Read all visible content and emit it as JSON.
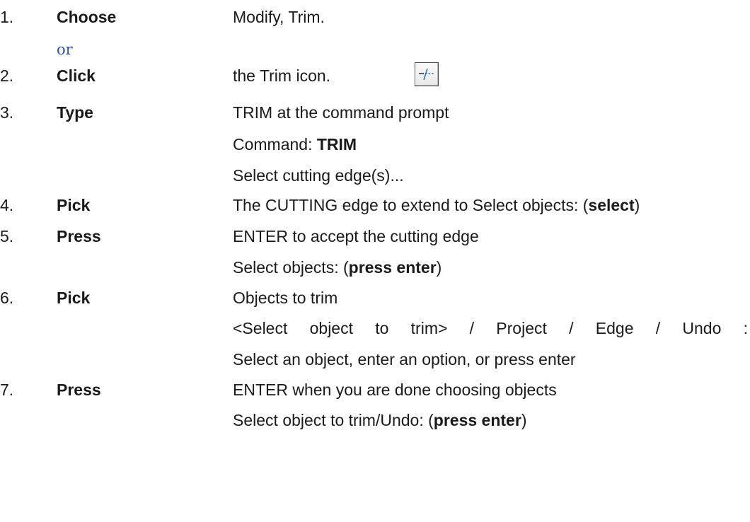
{
  "steps": [
    {
      "number": "1.",
      "verb": "Choose",
      "desc": "Modify, Trim."
    },
    {
      "number": "2.",
      "verb": "Click",
      "desc": "the Trim icon.",
      "icon": "trim-icon"
    },
    {
      "number": "3.",
      "verb": "Type",
      "desc": "TRIM at the command prompt",
      "command_prefix": "Command: ",
      "command_bold": "TRIM",
      "note": "Select cutting edge(s)..."
    },
    {
      "number": "4.",
      "verb": "Pick",
      "desc_prefix": "The CUTTING edge to extend to Select objects: (",
      "desc_bold": "select",
      "desc_suffix": ")"
    },
    {
      "number": "5.",
      "verb": "Press",
      "desc": "ENTER to accept the cutting edge",
      "prompt_prefix": "Select objects: (",
      "prompt_bold": "press enter",
      "prompt_suffix": ")"
    },
    {
      "number": "6.",
      "verb": "Pick",
      "desc": "Objects to trim",
      "options_line": "<Select object to trim> / Project / Edge / Undo :",
      "options_line2": "Select an object, enter an option, or press enter"
    },
    {
      "number": "7.",
      "verb": "Press",
      "desc": "ENTER when you are done choosing objects",
      "prompt_prefix": "Select object to trim/Undo: (",
      "prompt_bold": "press enter",
      "prompt_suffix": ")"
    }
  ],
  "or_text": "or",
  "colors": {
    "text": "#1a1a1a",
    "or_text": "#2f5496",
    "icon_line": "#1f6fd1"
  }
}
